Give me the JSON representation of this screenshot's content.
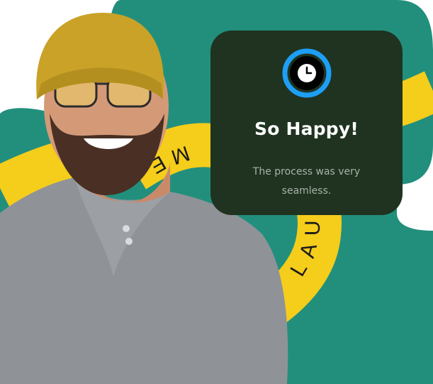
{
  "banner": {
    "text": "KEY TO LAUNCHING ME",
    "colors": {
      "teal": "#228f7d",
      "yellow": "#f5cd1b",
      "ink": "#1b1b1b"
    }
  },
  "person": {
    "description_icon": "smiling-man-photo"
  },
  "card": {
    "icon": "clock-icon",
    "title": "So Happy!",
    "text": "The process was very seamless.",
    "colors": {
      "background": "#1f3320",
      "ring": "#1e9ef5",
      "text_muted": "#a9b2a9"
    }
  }
}
